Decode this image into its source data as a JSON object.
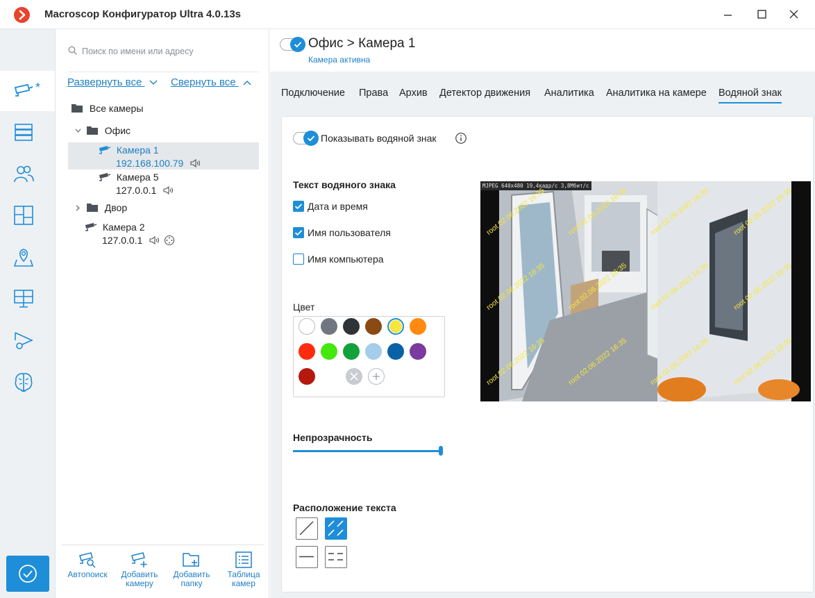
{
  "window": {
    "title": "Macroscop Конфигуратор Ultra 4.0.13s"
  },
  "rail": {
    "active_badge": "*"
  },
  "tree": {
    "search_placeholder": "Поиск по имени или адресу",
    "expand_all": "Развернуть все",
    "collapse_all": "Свернуть все",
    "root": "Все камеры",
    "folders": [
      {
        "name": "Офис",
        "cameras": [
          {
            "name": "Камера 1",
            "address": "192.168.100.79"
          },
          {
            "name": "Камера 5",
            "address": "127.0.0.1"
          }
        ]
      },
      {
        "name": "Двор"
      }
    ],
    "loose_camera": {
      "name": "Камера 2",
      "address": "127.0.0.1"
    },
    "bottom_tools": [
      "Автопоиск",
      "Добавить камеру",
      "Добавить папку",
      "Таблица камер"
    ]
  },
  "header": {
    "title": "Офис > Камера 1",
    "subtitle": "Камера активна"
  },
  "tabs": [
    {
      "label": "Подключение"
    },
    {
      "label": "Права"
    },
    {
      "label": "Архив"
    },
    {
      "label": "Детектор движения"
    },
    {
      "label": "Аналитика"
    },
    {
      "label": "Аналитика на камере"
    },
    {
      "label": "Водяной знак",
      "active": true
    }
  ],
  "watermark": {
    "show_label": "Показывать водяной знак",
    "show_enabled": true,
    "text_section": "Текст водяного знака",
    "options": [
      {
        "label": "Дата и время",
        "checked": true
      },
      {
        "label": "Имя пользователя",
        "checked": true
      },
      {
        "label": "Имя компьютера",
        "checked": false
      }
    ],
    "color_section": "Цвет",
    "colors": [
      "#ffffff",
      "#707780",
      "#2f3439",
      "#8a4a14",
      "#f6e640",
      "#ff8a0f",
      "#ff2b0f",
      "#44e80f",
      "#13a13b",
      "#a4cdea",
      "#0a62a6",
      "#7a3a9e",
      "#b5190e"
    ],
    "selected_color": "#f6e640",
    "opacity_section": "Непрозрачность",
    "opacity": 1.0,
    "position_section": "Расположение текста",
    "position_selected": "diagonal-tiled",
    "preview": {
      "osd": "MJPEG 640x480 19,4кадр/с 3,8Мбит/с",
      "watermark_text": "root 02.06.2022 16:35"
    }
  }
}
